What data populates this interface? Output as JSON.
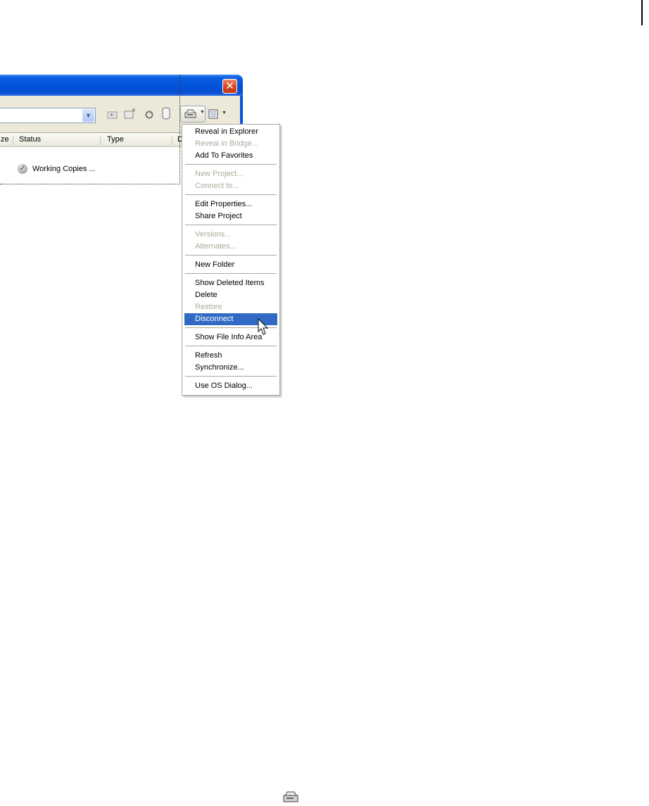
{
  "window": {
    "close_glyph": "✕",
    "combo_arrow": "▼",
    "columns": [
      "ze",
      "Status",
      "Type",
      "D"
    ],
    "row": {
      "status_text": "Working Copies ..."
    }
  },
  "menu": {
    "items": [
      {
        "label": "Reveal in Explorer",
        "enabled": true
      },
      {
        "label": "Reveal in Bridge...",
        "enabled": false
      },
      {
        "label": "Add To Favorites",
        "enabled": true
      },
      {
        "label": "New Project...",
        "enabled": false
      },
      {
        "label": "Connect to...",
        "enabled": false
      },
      {
        "label": "Edit Properties...",
        "enabled": true
      },
      {
        "label": "Share Project",
        "enabled": true
      },
      {
        "label": "Versions...",
        "enabled": false
      },
      {
        "label": "Alternates...",
        "enabled": false
      },
      {
        "label": "New Folder",
        "enabled": true
      },
      {
        "label": "Show Deleted Items",
        "enabled": true
      },
      {
        "label": "Delete",
        "enabled": true
      },
      {
        "label": "Restore",
        "enabled": false
      },
      {
        "label": "Disconnect",
        "enabled": true,
        "highlighted": true
      },
      {
        "label": "Show File Info Area",
        "enabled": true
      },
      {
        "label": "Refresh",
        "enabled": true
      },
      {
        "label": "Synchronize...",
        "enabled": true
      },
      {
        "label": "Use OS Dialog...",
        "enabled": true
      }
    ]
  },
  "colors": {
    "titlebar": "#0052d9",
    "menu_highlight": "#316ac5",
    "disabled_text": "#aca899"
  },
  "icons": [
    "close-icon",
    "combo-arrow-icon",
    "back-icon",
    "new-folder-icon",
    "refresh-icon",
    "database-icon",
    "drive-menu-icon",
    "view-menu-icon",
    "checkmark-icon",
    "mouse-cursor-icon",
    "drive-icon"
  ]
}
